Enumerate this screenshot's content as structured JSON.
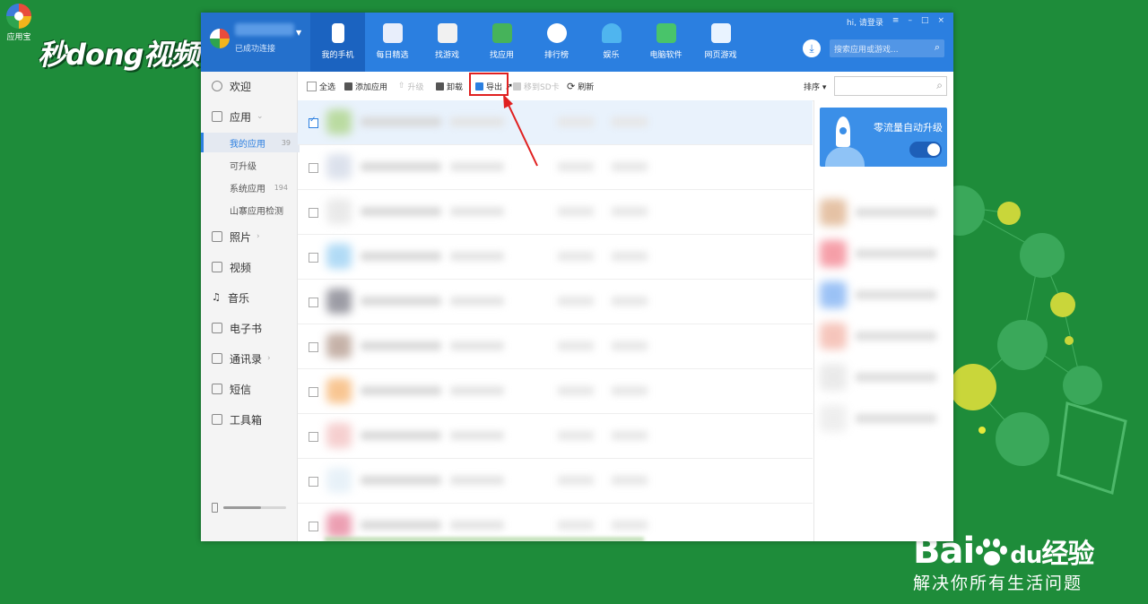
{
  "desktop": {
    "icon_label": "应用宝",
    "video_watermark": "秒dong视频",
    "baidu_brand": "Bai",
    "baidu_du": "du",
    "baidu_jingyan": "经验",
    "baidu_slogan": "解决你所有生活问题"
  },
  "window": {
    "account": {
      "status": "已成功连接"
    },
    "nav_tabs": [
      {
        "label": "我的手机",
        "icon": "phone-icon",
        "active": true
      },
      {
        "label": "每日精选",
        "icon": "calendar-star-icon"
      },
      {
        "label": "找游戏",
        "icon": "gamepad-icon"
      },
      {
        "label": "找应用",
        "icon": "android-bag-icon"
      },
      {
        "label": "排行榜",
        "icon": "medal-icon"
      },
      {
        "label": "娱乐",
        "icon": "tv-icon"
      },
      {
        "label": "电脑软件",
        "icon": "monitor-icon"
      },
      {
        "label": "网页游戏",
        "icon": "web-game-icon"
      }
    ],
    "controls": {
      "login": "hi, 请登录",
      "menu": "≡",
      "min": "–",
      "max": "□",
      "close": "×"
    },
    "top_search": {
      "placeholder": "搜索应用或游戏..."
    },
    "sidebar": {
      "items": [
        {
          "label": "欢迎"
        },
        {
          "label": "应用"
        },
        {
          "label": "照片"
        },
        {
          "label": "视频"
        },
        {
          "label": "音乐"
        },
        {
          "label": "电子书"
        },
        {
          "label": "通讯录"
        },
        {
          "label": "短信"
        },
        {
          "label": "工具箱"
        }
      ],
      "sub_items": [
        {
          "label": "我的应用",
          "count": "39",
          "active": true
        },
        {
          "label": "可升级",
          "count": ""
        },
        {
          "label": "系统应用",
          "count": "194"
        },
        {
          "label": "山寨应用检测",
          "count": ""
        }
      ],
      "storage_used_fraction": 0.6
    },
    "toolbar": {
      "select_all": "全选",
      "add_app": "添加应用",
      "upgrade": "升级",
      "uninstall": "卸载",
      "export": "导出",
      "move_sd": "移到SD卡",
      "refresh": "刷新",
      "sort": "排序 ▾"
    },
    "right_panel": {
      "banner_text": "零流量自动升级",
      "toggle_on": true
    }
  },
  "colors": {
    "desktop_green": "#1e8c3a",
    "app_blue": "#2b7fe0",
    "highlight_red": "#e02020"
  }
}
